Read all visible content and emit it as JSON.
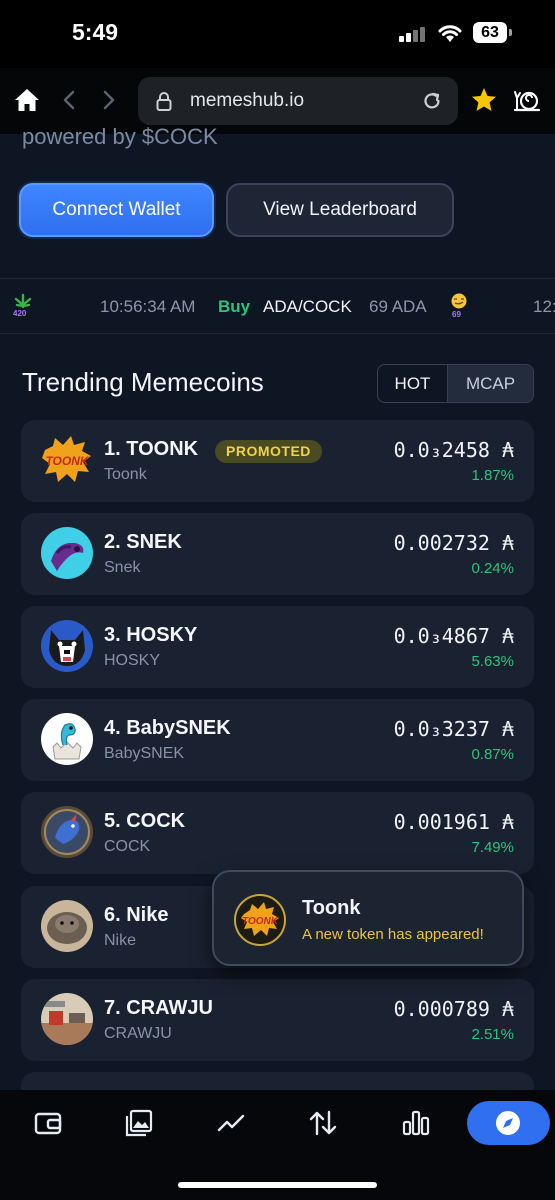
{
  "status_bar": {
    "time": "5:49",
    "battery": "63"
  },
  "browser": {
    "url": "memeshub.io"
  },
  "hero": {
    "partial_text": "powered by $COCK",
    "connect_wallet_label": "Connect Wallet",
    "leaderboard_label": "View Leaderboard"
  },
  "ticker": {
    "leaf_tag": "420",
    "time": "10:56:34 AM",
    "action": "Buy",
    "pair": "ADA/COCK",
    "amount": "69 ADA",
    "emoji_tag": "69",
    "next_partial": "12:"
  },
  "trending": {
    "title": "Trending Memecoins",
    "tabs": {
      "hot": "HOT",
      "mcap": "MCAP"
    },
    "promoted_badge": "PROMOTED",
    "coins": [
      {
        "name": "1. TOONK",
        "ticker": "Toonk",
        "price": "0.0₃2458 ₳",
        "change": "1.87%",
        "logo_color": "#d9421f"
      },
      {
        "name": "2. SNEK",
        "ticker": "Snek",
        "price": "0.002732 ₳",
        "change": "0.24%",
        "logo_color": "#2fc6e0"
      },
      {
        "name": "3. HOSKY",
        "ticker": "HOSKY",
        "price": "0.0₃4867 ₳",
        "change": "5.63%",
        "logo_color": "#2a56c4"
      },
      {
        "name": "4. BabySNEK",
        "ticker": "BabySNEK",
        "price": "0.0₃3237 ₳",
        "change": "0.87%",
        "logo_color": "#ffffff"
      },
      {
        "name": "5. COCK",
        "ticker": "COCK",
        "price": "0.001961 ₳",
        "change": "7.49%",
        "logo_color": "#4a5b7a"
      },
      {
        "name": "6. Nike",
        "ticker": "Nike",
        "price": "",
        "change": "",
        "logo_color": "#7a6b55"
      },
      {
        "name": "7. CRAWJU",
        "ticker": "CRAWJU",
        "price": "0.000789 ₳",
        "change": "2.51%",
        "logo_color": "#8a5a40"
      }
    ]
  },
  "toast": {
    "title": "Toonk",
    "message": "A new token has appeared!"
  },
  "colors": {
    "accent": "#2f6ff0",
    "positive": "#2fc37a",
    "promoted": "#f0d24b"
  }
}
